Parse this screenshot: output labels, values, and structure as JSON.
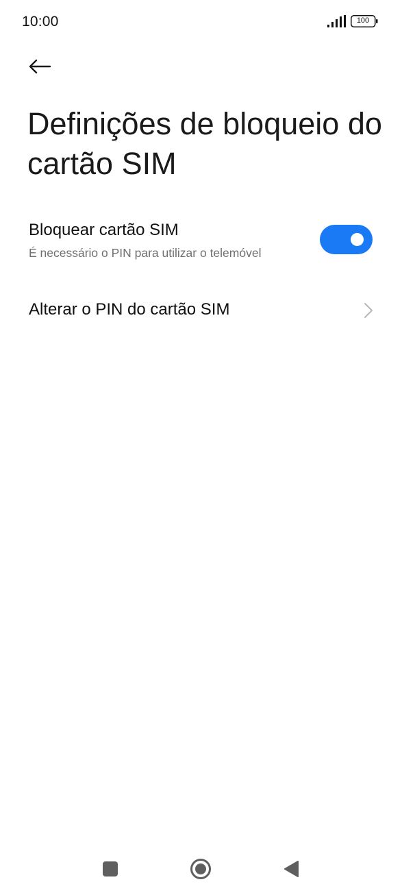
{
  "status_bar": {
    "time": "10:00",
    "battery": "100",
    "icons": [
      "signal-icon",
      "battery-icon"
    ]
  },
  "header": {
    "back_icon": "arrow-left-icon",
    "title": "Definições de bloqueio do cartão SIM"
  },
  "settings": {
    "lock_sim": {
      "title": "Bloquear cartão SIM",
      "subtitle": "É necessário o PIN para utilizar o telemóvel",
      "enabled": true
    },
    "change_pin": {
      "title": "Alterar o PIN do cartão SIM",
      "icon": "chevron-right-icon"
    }
  },
  "nav_bar": {
    "icons": [
      "recents-square-icon",
      "home-circle-icon",
      "back-triangle-icon"
    ]
  },
  "colors": {
    "accent": "#1a79f5",
    "background": "#ffffff",
    "subtitle": "#707070"
  }
}
